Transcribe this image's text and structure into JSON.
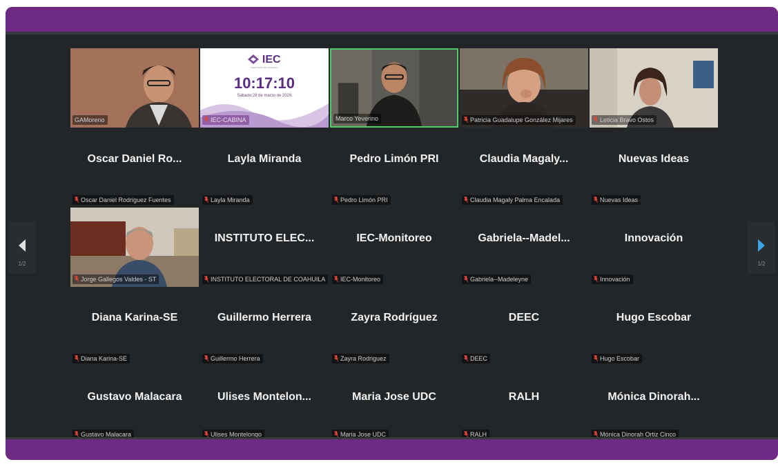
{
  "colors": {
    "accent": "#6f2b83",
    "background": "#232629",
    "active_speaker": "#4ccf6a",
    "clock": "#5b2c83"
  },
  "navigation": {
    "prev_page": "1/2",
    "next_page": "1/2"
  },
  "video_tiles": [
    {
      "label": "GAMoreno",
      "muted": false
    },
    {
      "label": "IEC-CABINA",
      "muted": true,
      "slide": {
        "logo": "IEC",
        "logo_subtitle": "ELECTORAL DE COAHUILA",
        "time": "10:17:10",
        "date": "Sábado 28 de marzo de 2026"
      }
    },
    {
      "label": "Marco Yeverino",
      "muted": false,
      "active": true
    },
    {
      "label": "Patricia Guadalupe González Mijares",
      "muted": true
    },
    {
      "label": "Leticia Bravo Ostos",
      "muted": true
    }
  ],
  "participants_row2": [
    {
      "name": "Oscar Daniel Ro...",
      "label": "Oscar Daniel Rodriguez Fuentes"
    },
    {
      "name": "Layla Miranda",
      "label": "Layla Miranda"
    },
    {
      "name": "Pedro Limón PRI",
      "label": "Pedro Limón PRI"
    },
    {
      "name": "Claudia Magaly...",
      "label": "Claudia Magaly Palma Encalada"
    },
    {
      "name": "Nuevas Ideas",
      "label": "Nuevas Ideas"
    }
  ],
  "participants_row3": [
    {
      "name": "",
      "label": "Jorge Gallegos Valdes - ST",
      "video": true
    },
    {
      "name": "INSTITUTO ELEC...",
      "label": "INSTITUTO ELECTORAL DE COAHUILA"
    },
    {
      "name": "IEC-Monitoreo",
      "label": "IEC-Monitoreo"
    },
    {
      "name": "Gabriela--Madel...",
      "label": "Gabriela--Madeleyne"
    },
    {
      "name": "Innovación",
      "label": "Innovación"
    }
  ],
  "participants_row4": [
    {
      "name": "Diana Karina-SE",
      "label": "Diana Karina-SE"
    },
    {
      "name": "Guillermo Herrera",
      "label": "Guillermo Herrera"
    },
    {
      "name": "Zayra Rodríguez",
      "label": "Zayra Rodriguez"
    },
    {
      "name": "DEEC",
      "label": "DEEC"
    },
    {
      "name": "Hugo Escobar",
      "label": "Hugo Escobar"
    }
  ],
  "participants_row5": [
    {
      "name": "Gustavo Malacara",
      "label": "Gustavo Malacara"
    },
    {
      "name": "Ulises Montelon...",
      "label": "Ulises Montelongo"
    },
    {
      "name": "Maria Jose UDC",
      "label": "Maria Jose UDC"
    },
    {
      "name": "RALH",
      "label": "RALH"
    },
    {
      "name": "Mónica Dinorah...",
      "label": "Mónica Dinorah Ortiz Cinco"
    }
  ]
}
